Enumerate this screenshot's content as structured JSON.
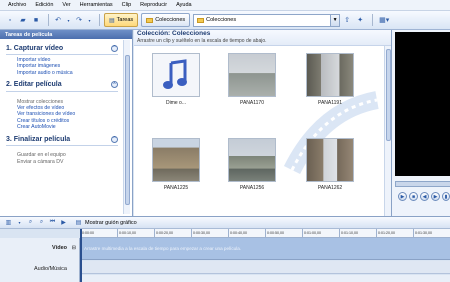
{
  "menu": [
    "Archivo",
    "Edición",
    "Ver",
    "Herramientas",
    "Clip",
    "Reproducir",
    "Ayuda"
  ],
  "toolbar": {
    "tasks_label": "Tareas",
    "collections_label": "Colecciones",
    "combo_value": "Colecciones"
  },
  "tasks": {
    "header": "Tareas de película",
    "sections": [
      {
        "title": "1. Capturar vídeo",
        "links": [
          "Importar vídeo",
          "Importar imágenes",
          "Importar audio o música"
        ]
      },
      {
        "title": "2. Editar película",
        "plain": [
          "Mostrar colecciones"
        ],
        "links": [
          "Ver efectos de vídeo",
          "Ver transiciones de vídeo",
          "Crear títulos o créditos",
          "Crear AutoMovie"
        ]
      },
      {
        "title": "3. Finalizar película",
        "plain": [
          "Guardar en el equipo",
          "Enviar a cámara DV"
        ]
      }
    ]
  },
  "collection": {
    "title": "Colección: Colecciones",
    "subtitle": "Arrastre un clip y suéltelo en la escala de tiempo de abajo.",
    "clips": [
      {
        "label": "Dime o...",
        "kind": "music"
      },
      {
        "label": "PANA1170",
        "kind": "photo-harbor"
      },
      {
        "label": "PANA1191",
        "kind": "photo-building"
      },
      {
        "label": "PANA1225",
        "kind": "photo-tower"
      },
      {
        "label": "PANA1256",
        "kind": "photo-city"
      },
      {
        "label": "PANA1262",
        "kind": "photo-street"
      }
    ]
  },
  "timeline": {
    "storyboard_label": "Mostrar guión gráfico",
    "ruler": [
      "0:00:00",
      "0:00:10,00",
      "0:00:20,00",
      "0:00:30,00",
      "0:00:40,00",
      "0:00:50,00",
      "0:01:00,00",
      "0:01:10,00",
      "0:01:20,00",
      "0:01:30,00"
    ],
    "video_label": "Vídeo",
    "audio_label": "Audio/Música",
    "video_hint": "Arrastre multimedia a la escala de tiempo para empezar a crear una película."
  },
  "colors": {
    "accent": "#4c6fae",
    "link": "#1c4fb3",
    "video_track": "#a8c1e4"
  }
}
